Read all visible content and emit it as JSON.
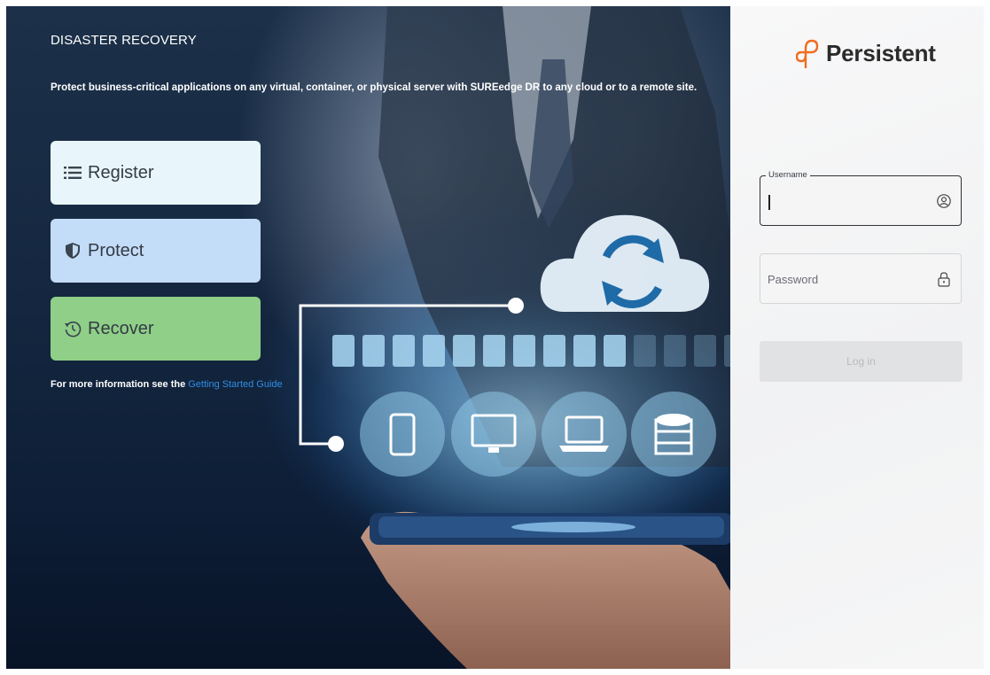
{
  "hero": {
    "title": "DISASTER RECOVERY",
    "tagline": "Protect business-critical applications on any virtual, container, or physical server with SUREedge DR to any cloud or to a remote site.",
    "actions": [
      {
        "label": "Register",
        "icon": "list-icon",
        "color": "#e8f6fb"
      },
      {
        "label": "Protect",
        "icon": "shield-icon",
        "color": "#c3dcf7"
      },
      {
        "label": "Recover",
        "icon": "restore-icon",
        "color": "#8fcf87"
      }
    ],
    "info_prefix": "For more information see the ",
    "info_link": "Getting Started Guide"
  },
  "login": {
    "brand": "Persistent",
    "brand_color": "#ef6c1f",
    "username_label": "Username",
    "username_value": "",
    "password_placeholder": "Password",
    "login_label": "Log in"
  }
}
